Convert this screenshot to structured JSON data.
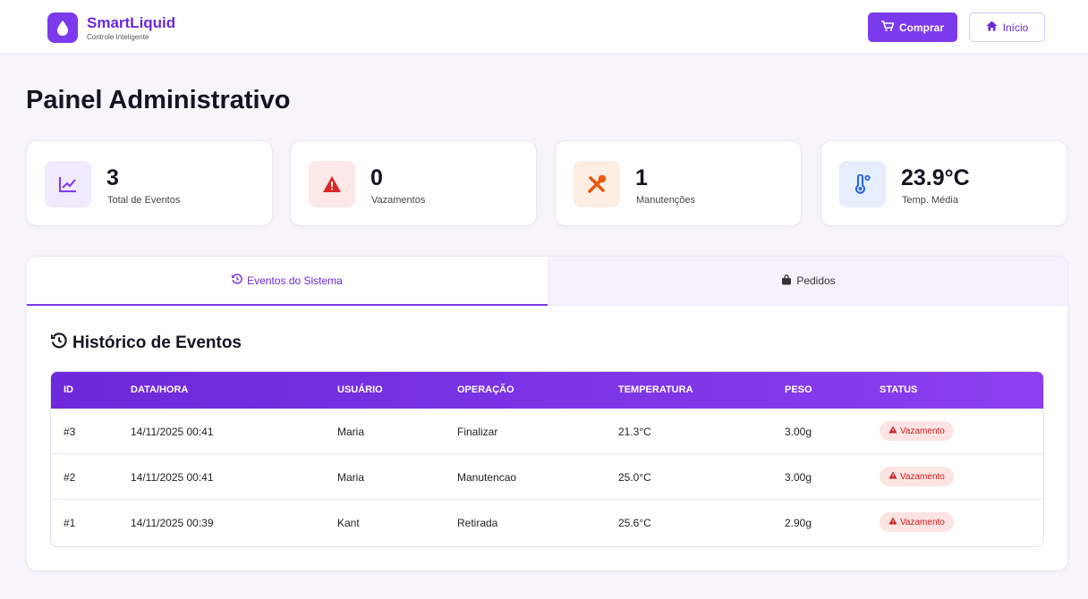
{
  "brand": {
    "name": "SmartLiquid",
    "subtitle": "Controle Inteligente"
  },
  "header": {
    "buy_label": "Comprar",
    "home_label": "Início"
  },
  "page": {
    "title": "Painel Administrativo"
  },
  "stats": [
    {
      "value": "3",
      "label": "Total de Eventos",
      "icon": "chart-line-icon",
      "color": "#7c3aed",
      "bg": "#f1e9fe"
    },
    {
      "value": "0",
      "label": "Vazamentos",
      "icon": "warning-icon",
      "color": "#dc2626",
      "bg": "#fde8e8"
    },
    {
      "value": "1",
      "label": "Manutenções",
      "icon": "tools-icon",
      "color": "#ea580c",
      "bg": "#fdeee3"
    },
    {
      "value": "23.9°C",
      "label": "Temp. Média",
      "icon": "thermometer-icon",
      "color": "#2563eb",
      "bg": "#e6eefd"
    }
  ],
  "tabs": [
    {
      "label": "Eventos do Sistema",
      "icon": "history-icon",
      "active": true
    },
    {
      "label": "Pedidos",
      "icon": "shopping-bag-icon",
      "active": false
    }
  ],
  "section": {
    "title": "Histórico de Eventos"
  },
  "table": {
    "headers": [
      "ID",
      "DATA/HORA",
      "USUÁRIO",
      "OPERAÇÃO",
      "TEMPERATURA",
      "PESO",
      "STATUS"
    ],
    "rows": [
      {
        "id": "#3",
        "datetime": "14/11/2025 00:41",
        "user": "Maria",
        "operation": "Finalizar",
        "temperature": "21.3°C",
        "weight": "3.00g",
        "status": "Vazamento"
      },
      {
        "id": "#2",
        "datetime": "14/11/2025 00:41",
        "user": "Maria",
        "operation": "Manutencao",
        "temperature": "25.0°C",
        "weight": "3.00g",
        "status": "Vazamento"
      },
      {
        "id": "#1",
        "datetime": "14/11/2025 00:39",
        "user": "Kant",
        "operation": "Retirada",
        "temperature": "25.6°C",
        "weight": "2.90g",
        "status": "Vazamento"
      }
    ]
  },
  "colors": {
    "accent": "#7c3aed",
    "danger": "#dc2626",
    "danger_bg": "#fde3e3"
  }
}
